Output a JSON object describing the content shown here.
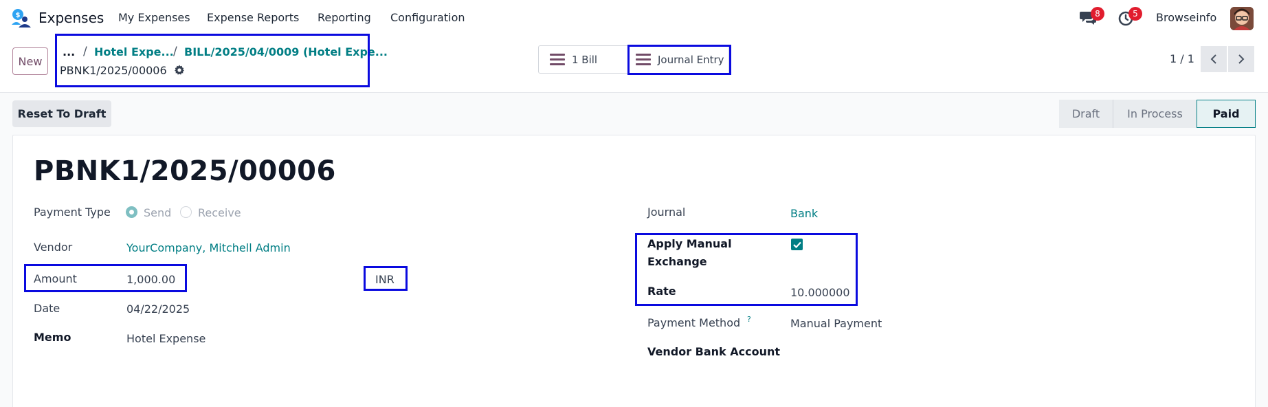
{
  "nav": {
    "app_name": "Expenses",
    "menu": [
      "My Expenses",
      "Expense Reports",
      "Reporting",
      "Configuration"
    ],
    "messages_count": "8",
    "activities_count": "5",
    "user_name": "Browseinfo"
  },
  "control": {
    "new_label": "New",
    "breadcrumb": {
      "ellipsis": "...",
      "sep": "/",
      "items": [
        "Hotel Expe...",
        "BILL/2025/04/0009 (Hotel Expe..."
      ]
    },
    "record_name": "PBNK1/2025/00006",
    "smart_buttons": {
      "bill": "1 Bill",
      "journal_entry": "Journal Entry"
    },
    "pager": "1 / 1"
  },
  "status": {
    "reset_label": "Reset To Draft",
    "steps": [
      "Draft",
      "In Process",
      "Paid"
    ],
    "active_step": "Paid"
  },
  "form": {
    "title": "PBNK1/2025/00006",
    "left": {
      "payment_type_label": "Payment Type",
      "payment_type_options": [
        "Send",
        "Receive"
      ],
      "payment_type_selected": "Send",
      "vendor_label": "Vendor",
      "vendor_value": "YourCompany, Mitchell Admin",
      "amount_label": "Amount",
      "amount_value": "1,000.00",
      "currency": "INR",
      "date_label": "Date",
      "date_value": "04/22/2025",
      "memo_label": "Memo",
      "memo_value": "Hotel Expense"
    },
    "right": {
      "journal_label": "Journal",
      "journal_value": "Bank",
      "apply_manual_label_line1": "Apply Manual",
      "apply_manual_label_line2": "Exchange",
      "apply_manual_checked": true,
      "rate_label": "Rate",
      "rate_value": "10.000000",
      "payment_method_label": "Payment Method",
      "payment_method_help": "?",
      "payment_method_value": "Manual Payment",
      "vendor_bank_label": "Vendor Bank Account"
    }
  },
  "colors": {
    "accent": "#017e84",
    "brand": "#714b67",
    "highlight": "#0a0adf",
    "badge": "#e11d2e"
  }
}
